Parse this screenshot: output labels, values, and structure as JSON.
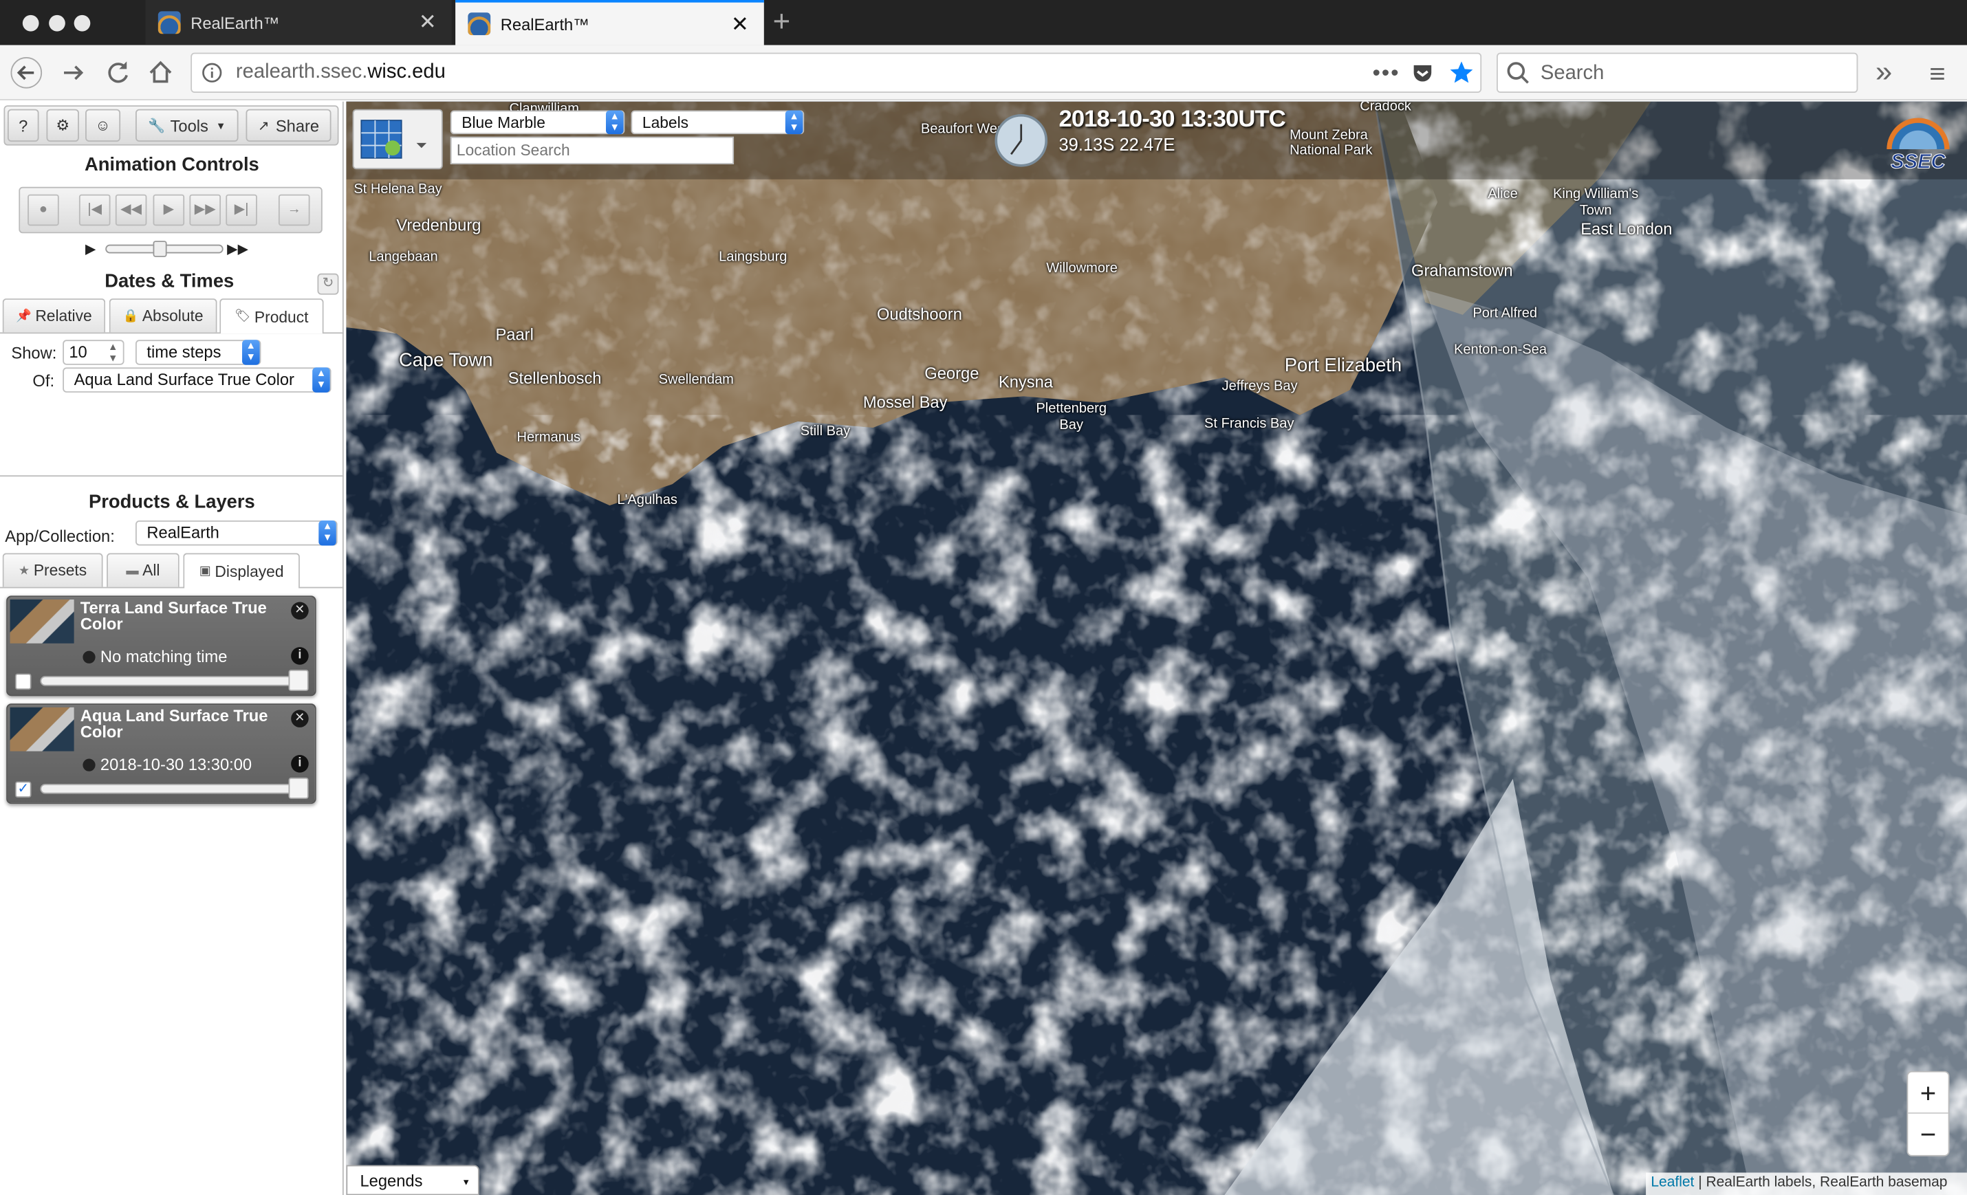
{
  "browser": {
    "tabs": [
      {
        "title": "RealEarth™",
        "close": "✕"
      },
      {
        "title": "RealEarth™",
        "close": "✕"
      }
    ],
    "new_tab": "+",
    "url_host": "realearth.ssec.",
    "url_domain": "wisc.edu",
    "search_placeholder": "Search",
    "overflow": "»",
    "menu": "≡"
  },
  "toolbar": {
    "help": "?",
    "settings": "⚙",
    "user": "☺",
    "tools": "Tools",
    "share": "Share"
  },
  "animation": {
    "title": "Animation Controls",
    "play_once": "▶",
    "play_loop": "▶▶"
  },
  "dates": {
    "title": "Dates & Times",
    "tabs": [
      "Relative",
      "Absolute",
      "Product"
    ],
    "show_label": "Show:",
    "show_value": "10",
    "unit": "time steps",
    "of_label": "Of:",
    "of_value": "Aqua Land Surface True Color"
  },
  "products": {
    "title": "Products & Layers",
    "collection_label": "App/Collection:",
    "collection_value": "RealEarth",
    "tabs": [
      "Presets",
      "All",
      "Displayed"
    ],
    "layers": [
      {
        "title": "Terra Land Surface True Color",
        "status": "No matching time",
        "checked": false
      },
      {
        "title": "Aqua Land Surface True Color",
        "status": "2018-10-30 13:30:00",
        "checked": true
      }
    ]
  },
  "map": {
    "basemap": "Blue Marble",
    "labels": "Labels",
    "search_placeholder": "Location Search",
    "datetime": "2018-10-30 13:30UTC",
    "coords": "39.13S 22.47E",
    "logo": "SSEC",
    "zoom_in": "+",
    "zoom_out": "−",
    "legends": "Legends",
    "attribution_link": "Leaflet",
    "attribution_text": "| RealEarth labels, RealEarth basemap",
    "places": [
      "Clanwilliam",
      "Beaufort West",
      "Cradock",
      "Mount Zebra National Park",
      "St Helena Bay",
      "Vredenburg",
      "Langebaan",
      "Laingsburg",
      "Alice",
      "King William's Town",
      "East London",
      "Willowmore",
      "Grahamstown",
      "Oudtshoorn",
      "Port Alfred",
      "Paarl",
      "Kenton-on-Sea",
      "Cape Town",
      "Stellenbosch",
      "Swellendam",
      "George",
      "Knysna",
      "Port Elizabeth",
      "Jeffreys Bay",
      "Mossel Bay",
      "Plettenberg Bay",
      "St Francis Bay",
      "Hermanus",
      "Still Bay",
      "L'Agulhas"
    ]
  }
}
